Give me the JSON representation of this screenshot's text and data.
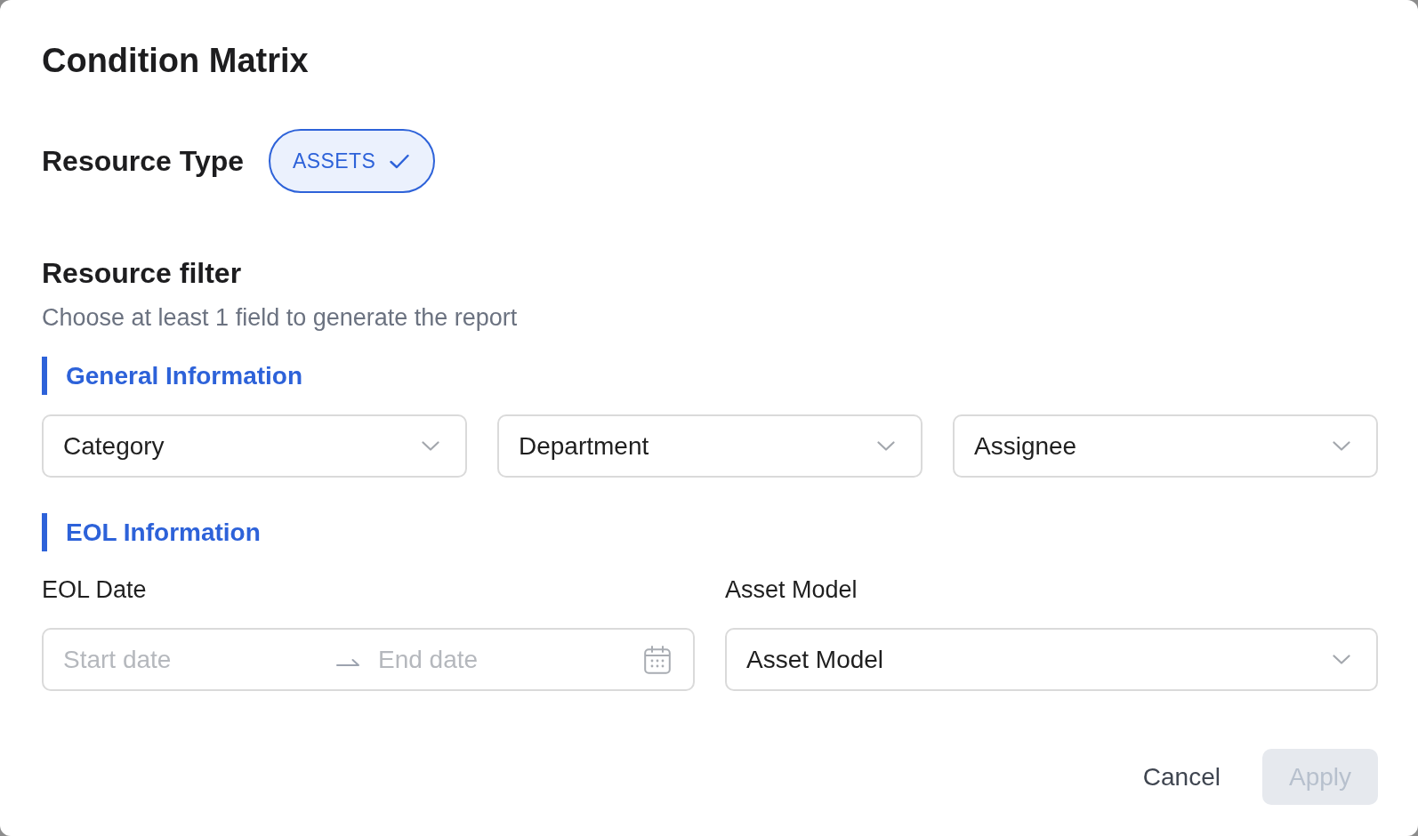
{
  "dialog": {
    "title": "Condition Matrix"
  },
  "resource_type": {
    "label": "Resource Type",
    "options": [
      {
        "label": "ASSETS",
        "selected": true
      }
    ]
  },
  "resource_filter": {
    "heading": "Resource filter",
    "hint": "Choose at least 1 field to generate the report",
    "sections": [
      {
        "title": "General Information",
        "fields": [
          {
            "kind": "select",
            "value": "Category"
          },
          {
            "kind": "select",
            "value": "Department"
          },
          {
            "kind": "select",
            "value": "Assignee"
          }
        ]
      },
      {
        "title": "EOL Information",
        "fields": [
          {
            "kind": "date_range",
            "label": "EOL Date",
            "start_placeholder": "Start date",
            "end_placeholder": "End date"
          },
          {
            "kind": "select",
            "label": "Asset Model",
            "value": "Asset Model"
          }
        ]
      }
    ]
  },
  "buttons": [
    {
      "kind": "text",
      "label": "Cancel",
      "disabled": false
    },
    {
      "kind": "primary",
      "label": "Apply",
      "disabled": true
    }
  ]
}
